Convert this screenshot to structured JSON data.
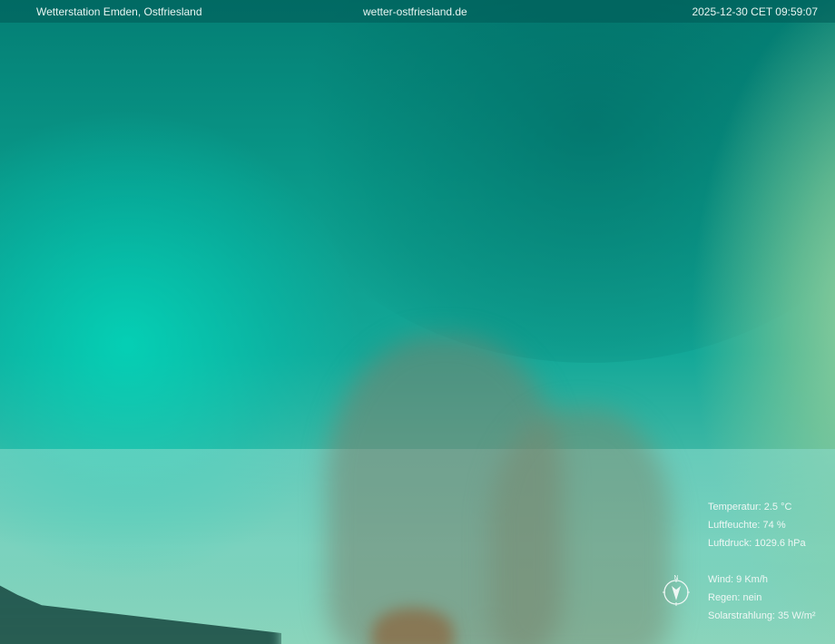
{
  "header": {
    "station": "Wetterstation Emden, Ostfriesland",
    "site": "wetter-ostfriesland.de",
    "timestamp": "2025-12-30 CET 09:59:07"
  },
  "readings": {
    "temperature": "Temperatur: 2.5 °C",
    "humidity": "Luftfeuchte: 74 %",
    "pressure": "Luftdruck: 1029.6 hPa",
    "wind": "Wind: 9 Km/h",
    "rain": "Regen: nein",
    "solar": "Solarstrahlung: 35 W/m²"
  },
  "compass": {
    "label": "N",
    "icon": "compass-arrow-icon"
  }
}
